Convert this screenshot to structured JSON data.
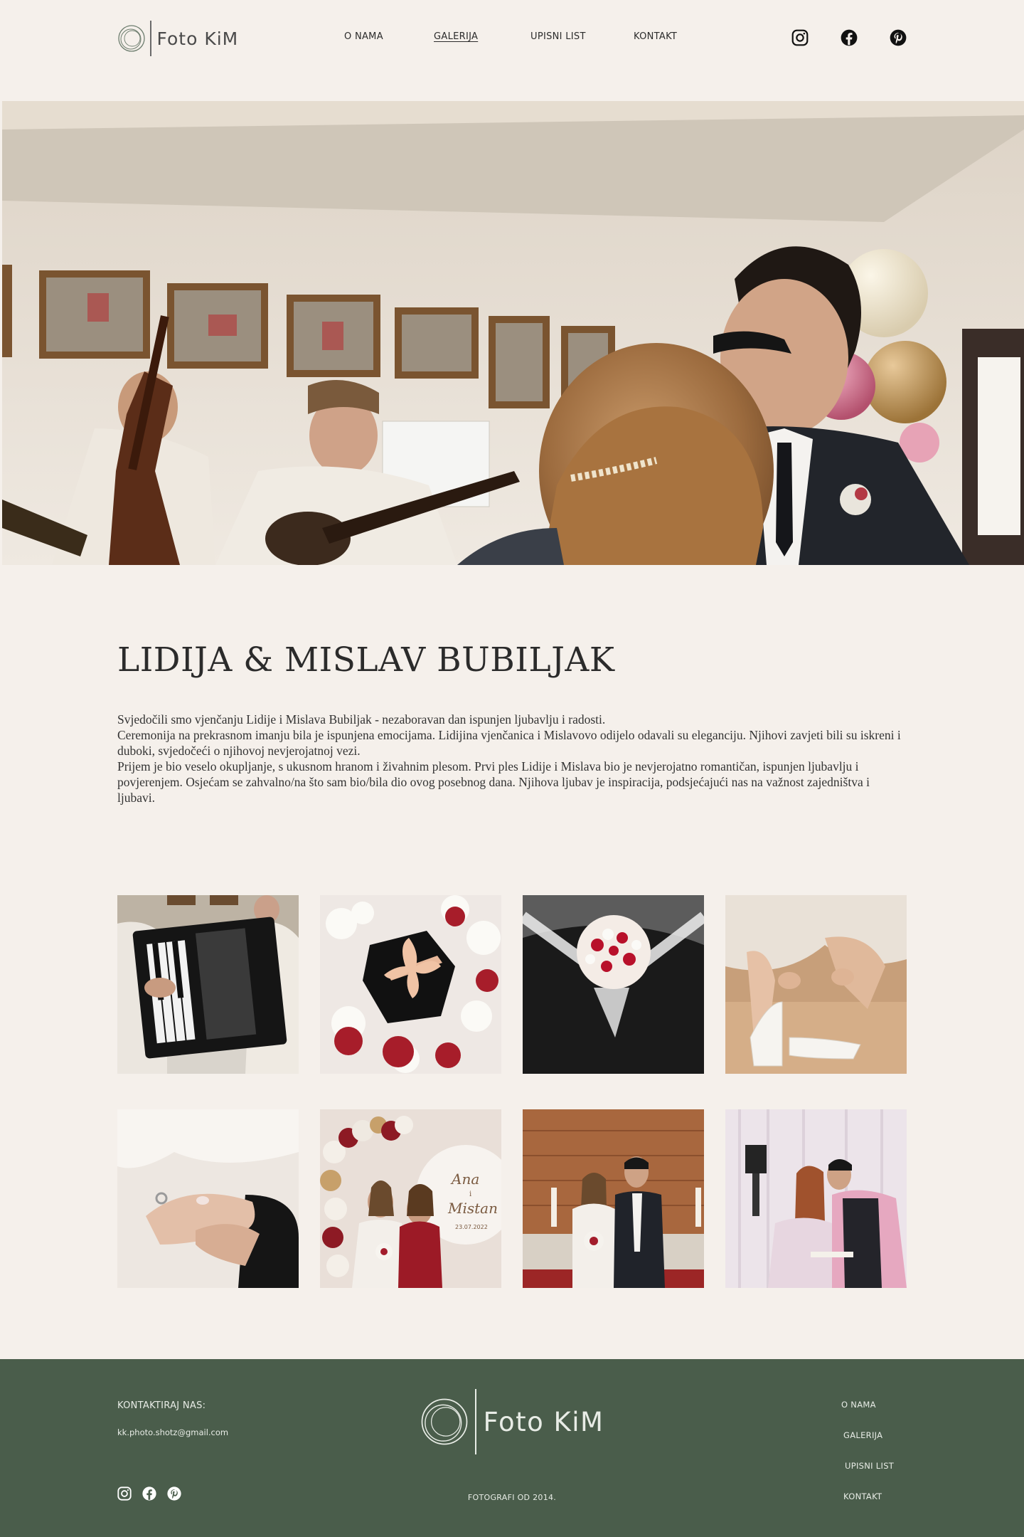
{
  "header": {
    "logo_text": "Foto KiM",
    "nav": [
      {
        "label": "O NAMA",
        "active": false
      },
      {
        "label": "GALERIJA",
        "active": true
      },
      {
        "label": "UPISNI LIST",
        "active": false
      },
      {
        "label": "KONTAKT",
        "active": false
      }
    ],
    "social": [
      "instagram-icon",
      "facebook-icon",
      "pinterest-icon"
    ]
  },
  "hero": {
    "image": "wedding couple embracing with tamburica band playing in background"
  },
  "article": {
    "title": "LIDIJA & MISLAV BUBILJAK",
    "paragraphs": [
      "Svjedočili smo vjenčanju Lidije i Mislava Bubiljak - nezaboravan dan ispunjen ljubavlju i radosti.",
      "Ceremonija na prekrasnom imanju bila je ispunjena emocijama. Lidijina vjenčanica i Mislavovo odijelo odavali su eleganciju. Njihovi zavjeti bili su iskreni i duboki, svjedočeći o njihovoj nevjerojatnoj vezi.",
      "Prijem je bio veselo okupljanje, s ukusnom hranom i živahnim plesom. Prvi ples Lidije i Mislava bio je nevjerojatno romantičan, ispunjen ljubavlju i povjerenjem. Osjećam se zahvalno/na što sam bio/bila dio ovog posebnog dana. Njihova ljubav je inspiracija, podsjećajući nas na važnost zajedništva i ljubavi."
    ]
  },
  "gallery": [
    "accordion player",
    "gift box with bow among roses",
    "bridal bouquet on car",
    "bride fastening white sandal",
    "wedding ring on hand",
    "bride with mother at balloon arch",
    "couple at church altar",
    "couple kissing at reception"
  ],
  "gallery_sign": {
    "line1": "Ana",
    "line2": "i",
    "line3": "Mistan",
    "date": "23.07.2022"
  },
  "footer": {
    "contact_label": "KONTAKTIRAJ NAS:",
    "email": "kk.photo.shotz@gmail.com",
    "logo_text": "Foto KiM",
    "tagline": "FOTOGRAFI OD 2014.",
    "nav": [
      "O NAMA",
      "GALERIJA",
      "UPISNI LIST",
      "KONTAKT"
    ],
    "social": [
      "instagram-icon",
      "facebook-icon",
      "pinterest-icon"
    ]
  },
  "colors": {
    "background": "#f5f0eb",
    "footer": "#4a5d4b",
    "text": "#2b2b2b"
  }
}
